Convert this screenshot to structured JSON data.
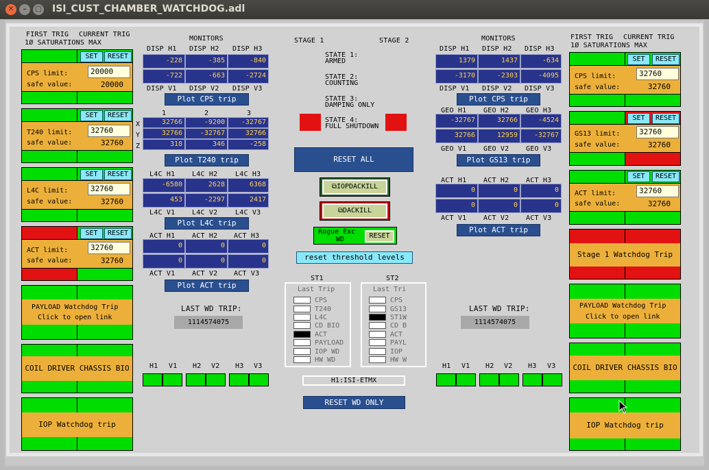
{
  "window": {
    "title": "ISI_CUST_CHAMBER_WATCHDOG.adl"
  },
  "left": {
    "hdr_first": "FIRST TRIG",
    "hdr_current": "CURRENT TRIG",
    "hdr_sat": "1Ø SATURATIONS MAX",
    "set": "SET",
    "reset": "RESET",
    "blocks": [
      {
        "label": "CPS limit:",
        "input": "20000",
        "safe": "safe value:",
        "value": "20000"
      },
      {
        "label": "T240 limit:",
        "input": "32760",
        "safe": "safe value:",
        "value": "32760"
      },
      {
        "label": "L4C limit:",
        "input": "32760",
        "safe": "safe value:",
        "value": "32760"
      },
      {
        "label": "ACT limit:",
        "input": "32760",
        "safe": "safe value:",
        "value": "32760"
      }
    ],
    "payload1": "PAYLOAD Watchdog Trip",
    "payload2": "Click to open link",
    "coil": "COIL DRIVER CHASSIS BIO",
    "iop": "IOP Watchdog trip"
  },
  "right": {
    "hdr_first": "FIRST TRIG",
    "hdr_current": "CURRENT TRIG",
    "hdr_sat": "1Ø SATURATIONS MAX",
    "set": "SET",
    "reset": "RESET",
    "blocks": [
      {
        "label": "CPS limit:",
        "input": "32760",
        "safe": "safe value:",
        "value": "32760"
      },
      {
        "label": "GS13 limit:",
        "input": "32760",
        "safe": "safe value:",
        "value": "32760"
      },
      {
        "label": "ACT limit:",
        "input": "32760",
        "safe": "safe value:",
        "value": "32760"
      }
    ],
    "stage1": "Stage 1 Watchdog Trip",
    "payload1": "PAYLOAD Watchdog Trip",
    "payload2": "Click to open link",
    "coil": "COIL DRIVER CHASSIS BIO",
    "iop": "IOP Watchdog trip"
  },
  "st1": {
    "monitors": "MONITORS",
    "disp_h": [
      "DISP H1",
      "DISP H2",
      "DISP H3"
    ],
    "disp_h_r1": [
      "-228",
      "-385",
      "-840"
    ],
    "disp_h_r2": [
      "-722",
      "-663",
      "-2724"
    ],
    "disp_v": [
      "DISP V1",
      "DISP V2",
      "DISP V3"
    ],
    "plot_cps": "Plot CPS trip",
    "t240_cols": [
      "1",
      "2",
      "3"
    ],
    "t240_rows": [
      "X",
      "Y",
      "Z"
    ],
    "t240": [
      [
        "32766",
        "-9200",
        "-32767"
      ],
      [
        "32766",
        "-32767",
        "32766"
      ],
      [
        "318",
        "346",
        "-258"
      ]
    ],
    "plot_t240": "Plot T240 trip",
    "l4c_h": [
      "L4C H1",
      "L4C H2",
      "L4C H3"
    ],
    "l4c_r1": [
      "-6580",
      "2628",
      "6368"
    ],
    "l4c_r2": [
      "453",
      "-2297",
      "2417"
    ],
    "l4c_v": [
      "L4C V1",
      "L4C V2",
      "L4C V3"
    ],
    "plot_l4c": "Plot L4C trip",
    "act_h": [
      "ACT H1",
      "ACT H2",
      "ACT H3"
    ],
    "act_r1": [
      "0",
      "0",
      "0"
    ],
    "act_r2": [
      "0",
      "0",
      "0"
    ],
    "act_v": [
      "ACT V1",
      "ACT V2",
      "ACT V3"
    ],
    "plot_act": "Plot ACT trip",
    "last_wd": "LAST WD TRIP:",
    "last_wd_val": "1114574075",
    "leds": [
      "H1",
      "V1",
      "H2",
      "V2",
      "H3",
      "V3"
    ]
  },
  "st2": {
    "monitors": "MONITORS",
    "disp_h": [
      "DISP H1",
      "DISP H2",
      "DISP H3"
    ],
    "disp_h_r1": [
      "1379",
      "1437",
      "-634"
    ],
    "disp_h_r2": [
      "-3170",
      "-2303",
      "-4095"
    ],
    "disp_v": [
      "DISP V1",
      "DISP V2",
      "DISP V3"
    ],
    "plot_cps": "Plot CPS trip",
    "geo_h": [
      "GEO H1",
      "GEO H2",
      "GEO H3"
    ],
    "geo_r1": [
      "-32767",
      "32766",
      "-4524"
    ],
    "geo_r2": [
      "32766",
      "12959",
      "-32767"
    ],
    "geo_v": [
      "GEO V1",
      "GEO V2",
      "GEO V3"
    ],
    "plot_gs13": "Plot GS13 trip",
    "act_h": [
      "ACT H1",
      "ACT H2",
      "ACT H3"
    ],
    "act_r1": [
      "0",
      "0",
      "0"
    ],
    "act_r2": [
      "0",
      "0",
      "0"
    ],
    "act_v": [
      "ACT V1",
      "ACT V2",
      "ACT V3"
    ],
    "plot_act": "Plot ACT trip",
    "last_wd": "LAST WD TRIP:",
    "last_wd_val": "1114574075",
    "leds": [
      "H1",
      "V1",
      "H2",
      "V2",
      "H3",
      "V3"
    ]
  },
  "center": {
    "stage1": "STAGE 1",
    "stage2": "STAGE 2",
    "state1a": "STATE 1:",
    "state1b": "ARMED",
    "state2a": "STATE 2:",
    "state2b": "COUNTING",
    "state3a": "STATE 3:",
    "state3b": "DAMPING ONLY",
    "state4a": "STATE 4:",
    "state4b": "FULL SHUTDOWN",
    "reset_all": "RESET ALL",
    "iopdackill": "IOPDACKILL",
    "dackill": "DACKILL",
    "rogue1": "Rogue Exc",
    "rogue2": "WD",
    "rogue_reset": "RESET",
    "reset_thresh": "reset threshold levels",
    "st1": "ST1",
    "st2": "ST2",
    "last_trip1": "Last Trip",
    "last_trip2": "Last Tri",
    "st1_items": [
      "CPS",
      "T240",
      "L4C",
      "CD BIO",
      "ACT",
      "PAYLOAD",
      "IOP WD",
      "HW WD"
    ],
    "st2_items": [
      "CPS",
      "GS13",
      "ST1W",
      "CD B",
      "ACT",
      "PAYL",
      "IOP",
      "HW W"
    ],
    "chamber": "H1:ISI-ETMX",
    "reset_wd": "RESET WD ONLY"
  },
  "colors": {
    "green": "#00dd00",
    "red": "#e21212",
    "orange": "#ecb03a",
    "navy": "#28348c",
    "cyan": "#8ae8f8"
  }
}
